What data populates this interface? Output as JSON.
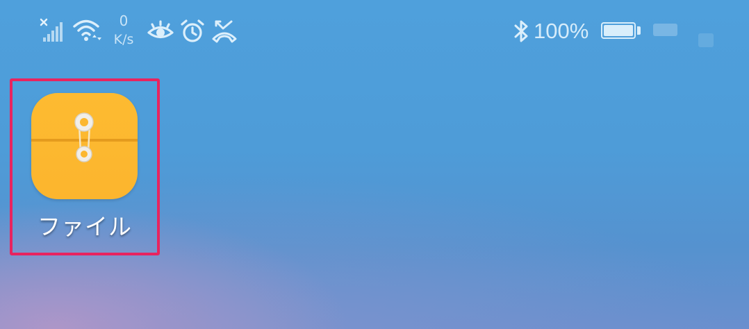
{
  "status_bar": {
    "net_speed_value": "0",
    "net_speed_unit": "K/s",
    "battery_percent": "100%",
    "icons": [
      "signal-off-icon",
      "wifi-icon",
      "eye-comfort-icon",
      "alarm-icon",
      "missed-call-icon",
      "bluetooth-icon",
      "battery-icon"
    ]
  },
  "home_screen": {
    "apps": [
      {
        "label": "ファイル",
        "icon": "files-folder-icon",
        "icon_color": "#fdb930",
        "selected": true
      }
    ],
    "highlight_color": "#e8245f"
  }
}
